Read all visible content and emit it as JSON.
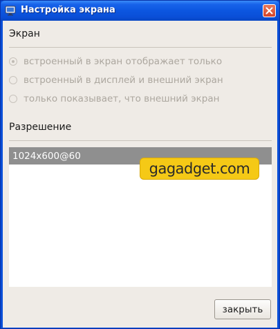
{
  "window": {
    "title": "Настройка экрана",
    "icons": {
      "app": "display-settings-icon",
      "close": "close-icon"
    }
  },
  "screen_section": {
    "label": "Экран",
    "options": [
      {
        "label": "встроенный в экран отображает только",
        "checked": true
      },
      {
        "label": "встроенный в дисплей и внешний экран",
        "checked": false
      },
      {
        "label": "только показывает, что внешний экран",
        "checked": false
      }
    ]
  },
  "resolution_section": {
    "label": "Разрешение",
    "items": [
      "1024x600@60"
    ],
    "selected_index": 0
  },
  "watermark": "gagadget.com",
  "buttons": {
    "close_label": "закрыть"
  },
  "colors": {
    "titlebar": "#0a4fd8",
    "client_bg": "#efebe6",
    "selection": "#8f8f8f",
    "watermark_bg": "#f5c916"
  }
}
